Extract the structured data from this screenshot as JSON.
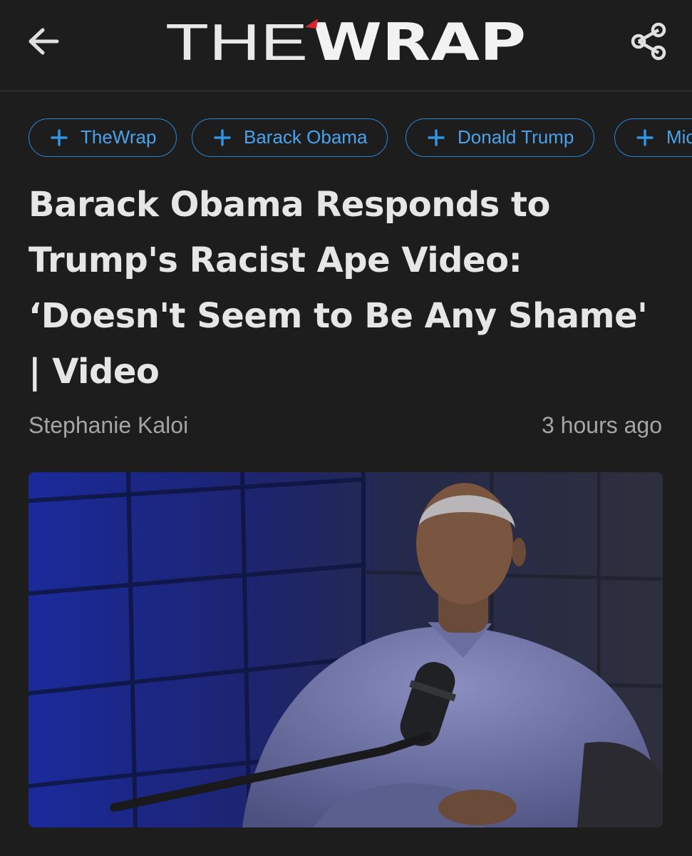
{
  "header": {
    "back_icon": "arrow-left-icon",
    "logo_the": "THE",
    "logo_wrap": "WRAP",
    "share_icon": "share-icon"
  },
  "tags": [
    {
      "label": "TheWrap"
    },
    {
      "label": "Barack Obama"
    },
    {
      "label": "Donald Trump"
    },
    {
      "label": "Mic"
    }
  ],
  "article": {
    "headline_lines": [
      "Barack Obama Responds to",
      "Trump's Racist Ape Video:",
      "‘Doesn't Seem to Be Any Shame'",
      "| Video"
    ],
    "author": "Stephanie Kaloi",
    "time": "3 hours ago"
  },
  "colors": {
    "background": "#1d1d1e",
    "accent_blue": "#2c86d1",
    "logo_red": "#d8262a"
  }
}
